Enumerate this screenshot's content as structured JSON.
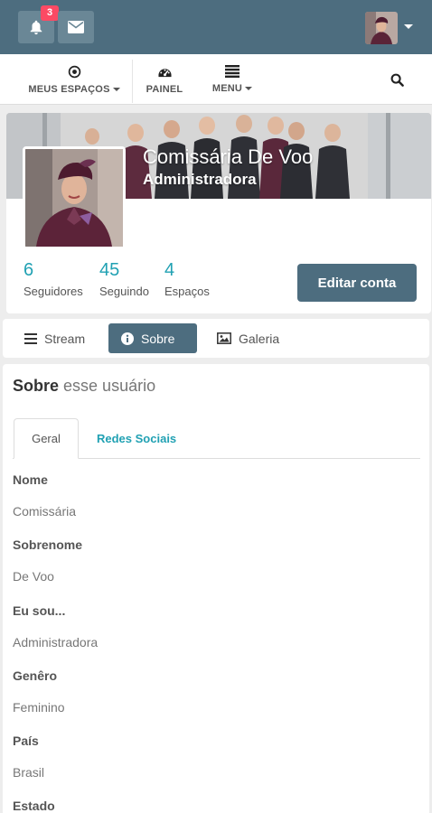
{
  "topbar": {
    "notification_count": "3",
    "icons": {
      "notifications": "bell-icon",
      "messages": "envelope-icon",
      "account_menu": "caret-down-icon"
    },
    "colors": {
      "bar": "#4d6d7f",
      "badge": "#fc4a64"
    }
  },
  "nav": {
    "items": [
      {
        "label": "MEUS ESPAÇOS",
        "icon": "dot-circle-icon",
        "dropdown": true
      },
      {
        "label": "PAINEL",
        "icon": "dashboard-icon",
        "dropdown": false
      },
      {
        "label": "MENU",
        "icon": "list-icon",
        "dropdown": true
      }
    ],
    "search_icon": "search-icon"
  },
  "profile": {
    "name": "Comissária De Voo",
    "role": "Administradora",
    "stats": [
      {
        "value": "6",
        "label": "Seguidores"
      },
      {
        "value": "45",
        "label": "Seguindo"
      },
      {
        "value": "4",
        "label": "Espaços"
      }
    ],
    "edit_button": "Editar conta",
    "accent": "#21a1b3"
  },
  "profile_tabs": [
    {
      "label": "Stream",
      "icon": "bars-icon",
      "active": false
    },
    {
      "label": "Sobre",
      "icon": "info-circle-icon",
      "active": true
    },
    {
      "label": "Galeria",
      "icon": "image-icon",
      "active": false
    }
  ],
  "about": {
    "heading_bold": "Sobre",
    "heading_rest": "esse usuário",
    "tabs": [
      {
        "label": "Geral",
        "active": true
      },
      {
        "label": "Redes Sociais",
        "active": false
      }
    ],
    "fields": [
      {
        "label": "Nome",
        "value": "Comissária"
      },
      {
        "label": "Sobrenome",
        "value": "De Voo"
      },
      {
        "label": "Eu sou...",
        "value": "Administradora"
      },
      {
        "label": "Genêro",
        "value": "Feminino"
      },
      {
        "label": "País",
        "value": "Brasil"
      },
      {
        "label": "Estado",
        "value": ""
      }
    ]
  }
}
